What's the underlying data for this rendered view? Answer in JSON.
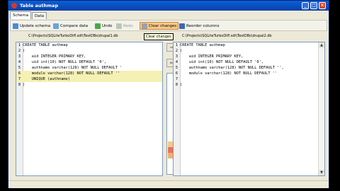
{
  "window": {
    "title": "Table authmap"
  },
  "title_buttons": {
    "minimize": "_",
    "maximize": "□",
    "close": "×"
  },
  "tabs": [
    {
      "label": "Schema"
    },
    {
      "label": "Data"
    }
  ],
  "toolbar": {
    "update_schema": "Update schema",
    "compare_data": "Compare data",
    "undo": "Undo",
    "redo": "Redo",
    "clear_changes": "Clear changes",
    "reorder_columns": "Reorder columns"
  },
  "tooltip": "Clear changes",
  "left_pane": {
    "path": "C:\\Projects\\SQLiteTurboDiff.sdt\\TestDBs\\drupal1.db",
    "lines": [
      {
        "num": "1",
        "text": "CREATE TABLE authmap"
      },
      {
        "num": "2",
        "text": "("
      },
      {
        "num": "3",
        "text": "    aid INTEGER PRIMARY KEY,"
      },
      {
        "num": "4",
        "text": "    uid int(10) NOT NULL DEFAULT '0',"
      },
      {
        "num": "5",
        "text": "    authname varchar(128) NOT NULL DEFAULT '"
      },
      {
        "num": "6",
        "text": "    module varchar(128) NOT NULL DEFAULT ''"
      },
      {
        "num": "7",
        "text": "    UNIQUE (authname)"
      },
      {
        "num": "8",
        "text": ")"
      }
    ]
  },
  "right_pane": {
    "path": "C:\\Projects\\SQLiteTurboDiff.sdt\\TestDBs\\drupal2.db",
    "lines": [
      {
        "num": "1",
        "text": "CREATE TABLE authmap"
      },
      {
        "num": "2",
        "text": "("
      },
      {
        "num": "3",
        "text": "    aid INTEGER PRIMARY KEY,"
      },
      {
        "num": "4",
        "text": "    uid int(10) NOT NULL DEFAULT '0',"
      },
      {
        "num": "5",
        "text": "    authname varchar(128) NOT NULL DEFAULT '',"
      },
      {
        "num": "6",
        "text": "    module varchar(128) NOT NULL DEFAULT ''"
      },
      {
        "num": "7",
        "text": ""
      },
      {
        "num": "8",
        "text": ")"
      }
    ]
  },
  "middle": {
    "copy_right_icon": "⇒",
    "copy_left_icon": "⇐"
  },
  "colors": {
    "changed_line": "#f5f0b4",
    "title_bar": "#0a5fd8",
    "highlight": "#f6c98a"
  }
}
